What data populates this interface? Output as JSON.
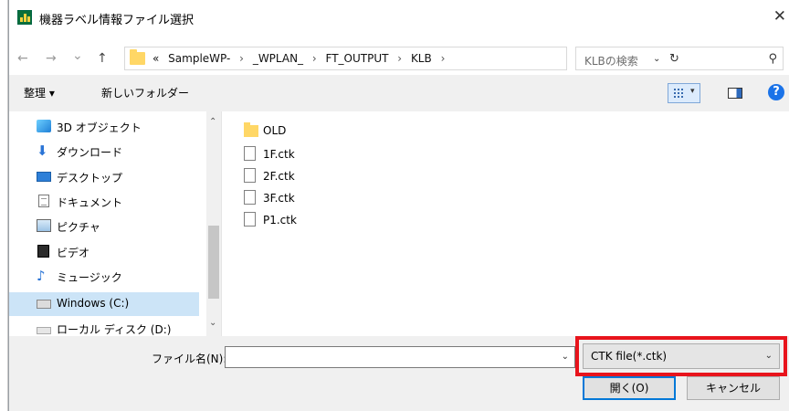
{
  "window": {
    "title": "機器ラベル情報ファイル選択",
    "close_glyph": "✕"
  },
  "nav": {
    "back_glyph": "←",
    "forward_glyph": "→",
    "recent_glyph": "⌄",
    "up_glyph": "↑"
  },
  "address": {
    "overflow": "«",
    "crumbs": [
      "SampleWP-",
      "_WPLAN_",
      "FT_OUTPUT",
      "KLB"
    ],
    "separator": "›",
    "dropdown_glyph": "⌄",
    "refresh_glyph": "↻"
  },
  "search": {
    "placeholder": "KLBの検索",
    "icon_glyph": "⚲"
  },
  "toolbar": {
    "organize": "整理 ▾",
    "new_folder": "新しいフォルダー",
    "view_dropdown": "▾",
    "help": "?"
  },
  "sidebar": {
    "items": [
      {
        "label": "3D オブジェクト",
        "icon": "3d-objects-icon"
      },
      {
        "label": "ダウンロード",
        "icon": "download-icon"
      },
      {
        "label": "デスクトップ",
        "icon": "desktop-icon"
      },
      {
        "label": "ドキュメント",
        "icon": "documents-icon"
      },
      {
        "label": "ピクチャ",
        "icon": "pictures-icon"
      },
      {
        "label": "ビデオ",
        "icon": "videos-icon"
      },
      {
        "label": "ミュージック",
        "icon": "music-icon"
      },
      {
        "label": "Windows (C:)",
        "icon": "drive-icon",
        "selected": true
      },
      {
        "label": "ローカル ディスク (D:)",
        "icon": "drive-icon"
      }
    ],
    "scroll_up": "⌃",
    "scroll_down": "⌄"
  },
  "files": [
    {
      "name": "OLD",
      "type": "folder"
    },
    {
      "name": "1F.ctk",
      "type": "file"
    },
    {
      "name": "2F.ctk",
      "type": "file"
    },
    {
      "name": "3F.ctk",
      "type": "file"
    },
    {
      "name": "P1.ctk",
      "type": "file"
    }
  ],
  "bottom": {
    "filename_label": "ファイル名(N):",
    "filename_value": "",
    "dropdown_glyph": "⌄",
    "filter_value": "CTK file(*.ctk)",
    "open_button": "開く(O)",
    "cancel_button": "キャンセル"
  },
  "colors": {
    "highlight": "#e8141c",
    "selection": "#cce4f7",
    "accent": "#0078d7"
  }
}
